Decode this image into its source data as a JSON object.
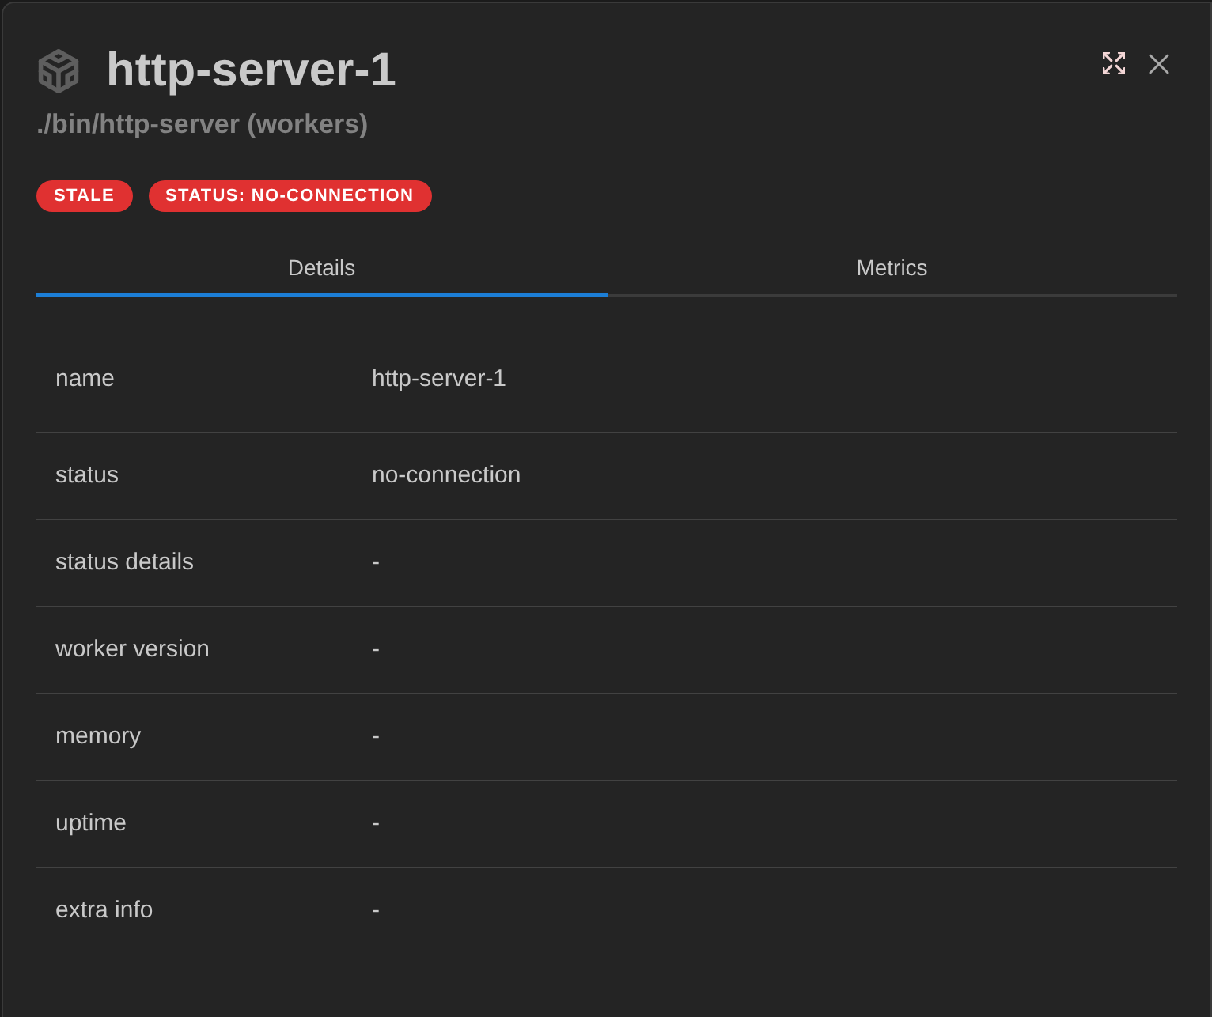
{
  "header": {
    "title": "http-server-1",
    "subtitle": "./bin/http-server (workers)"
  },
  "badges": [
    {
      "label": "STALE"
    },
    {
      "label": "STATUS: NO-CONNECTION"
    }
  ],
  "tabs": [
    {
      "label": "Details",
      "selected": true
    },
    {
      "label": "Metrics",
      "selected": false
    }
  ],
  "details": [
    {
      "label": "name",
      "value": "http-server-1"
    },
    {
      "label": "status",
      "value": "no-connection"
    },
    {
      "label": "status details",
      "value": "-"
    },
    {
      "label": "worker version",
      "value": "-"
    },
    {
      "label": "memory",
      "value": "-"
    },
    {
      "label": "uptime",
      "value": "-"
    },
    {
      "label": "extra info",
      "value": "-"
    }
  ]
}
